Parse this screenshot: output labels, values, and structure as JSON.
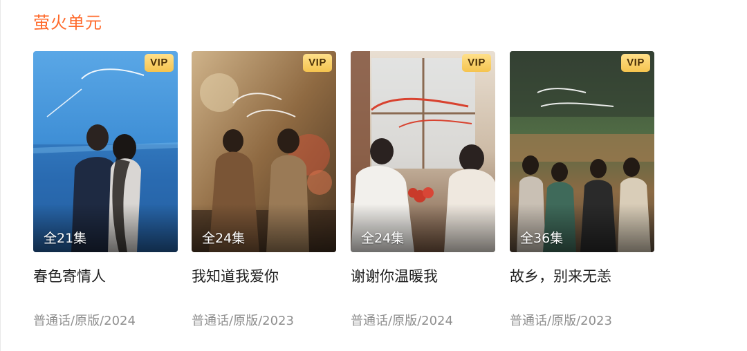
{
  "section": {
    "title": "萤火单元"
  },
  "cards": [
    {
      "badge": "VIP",
      "episodes": "全21集",
      "title": "春色寄情人",
      "meta": "普通话/原版/2024",
      "poster_text": "春色寄情人"
    },
    {
      "badge": "VIP",
      "episodes": "全24集",
      "title": "我知道我爱你",
      "meta": "普通话/原版/2023",
      "poster_text": "我知道我爱你"
    },
    {
      "badge": "VIP",
      "episodes": "全24集",
      "title": "谢谢你温暖我",
      "meta": "普通话/原版/2024",
      "poster_text": "谢谢你温暖我"
    },
    {
      "badge": "VIP",
      "episodes": "全36集",
      "title": "故乡，别来无恙",
      "meta": "普通话/原版/2023",
      "poster_text": "故乡，别来无恙"
    }
  ],
  "colors": {
    "section_title": "#ff6a2b",
    "vip_badge": "#f5c44f",
    "title_text": "#1f1f1f",
    "meta_text": "#8f8f8f"
  }
}
